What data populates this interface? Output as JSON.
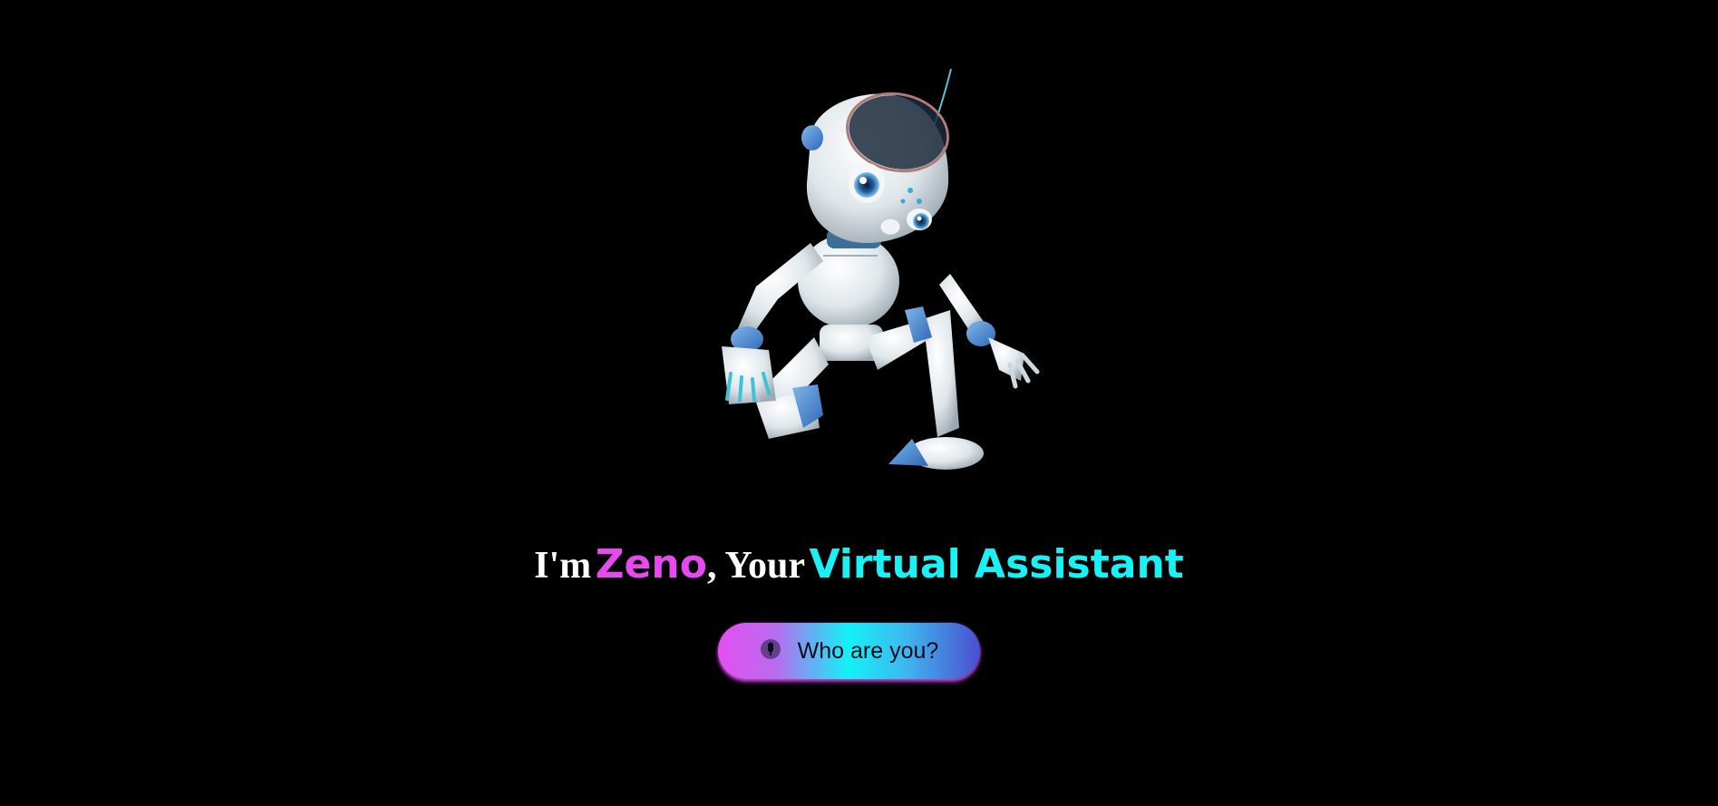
{
  "headline": {
    "part1": "I'm",
    "name": "Zeno",
    "part2": ", Your",
    "role": "Virtual Assistant"
  },
  "ask_button": {
    "label": "Who are you?",
    "icon": "mic-icon"
  },
  "colors": {
    "background": "#000000",
    "name_accent": "#e649ee",
    "role_accent": "#18f2f5",
    "button_gradient": [
      "#e44ff1",
      "#12f2f6",
      "#4a4fcf"
    ]
  }
}
